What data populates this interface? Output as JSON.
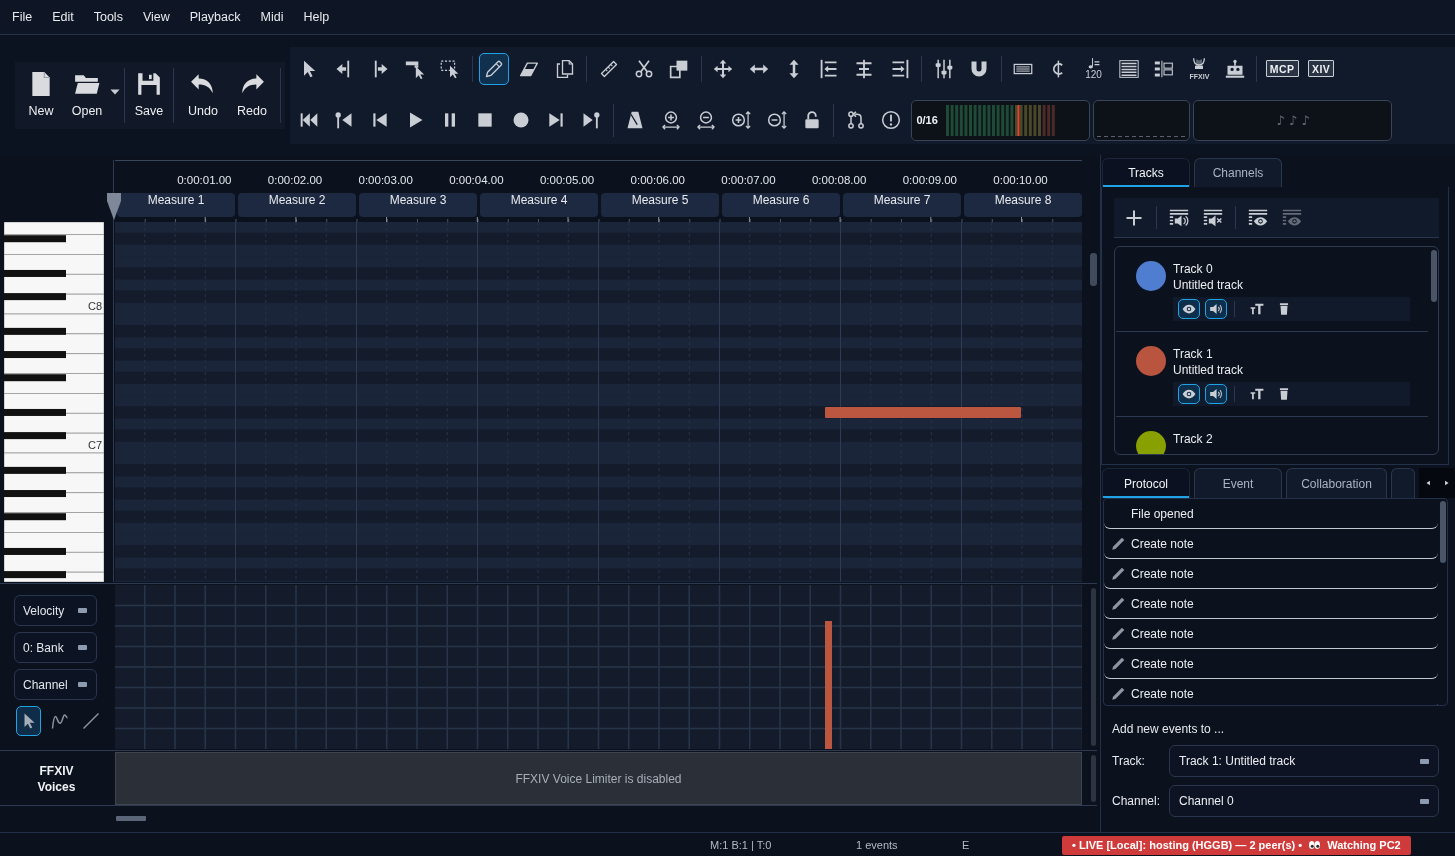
{
  "menu_bar": [
    "File",
    "Edit",
    "Tools",
    "View",
    "Playback",
    "Midi",
    "Help"
  ],
  "file_toolbar": [
    {
      "label": "New",
      "has_menu": false
    },
    {
      "label": "Open",
      "has_menu": true
    },
    {
      "label": "Save",
      "has_menu": false
    },
    {
      "label": "Undo",
      "has_menu": false
    },
    {
      "label": "Redo",
      "has_menu": false
    }
  ],
  "toolbar": {
    "edit_tools": [
      {
        "selected": false
      },
      {
        "selected": false
      },
      {
        "selected": false
      },
      {
        "selected": false
      },
      {
        "selected": false
      },
      {
        "selected": true
      },
      {
        "selected": false
      },
      {
        "selected": false
      }
    ],
    "tempo": "120",
    "ffxiv_label": "FFXIV",
    "mcp_label": "MCP",
    "xiv_label": "XIV",
    "position_counter": "0/16",
    "notes_indicator": "♪ ♪ ♪"
  },
  "ruler": {
    "times": [
      "0:00:01.00",
      "0:00:02.00",
      "0:00:03.00",
      "0:00:04.00",
      "0:00:05.00",
      "0:00:06.00",
      "0:00:07.00",
      "0:00:08.00",
      "0:00:09.00",
      "0:00:10.00"
    ],
    "measures": [
      "Measure 1",
      "Measure 2",
      "Measure 3",
      "Measure 4",
      "Measure 5",
      "Measure 6",
      "Measure 7",
      "Measure 8"
    ]
  },
  "piano_roll": {
    "octave_labels": [
      "C8",
      "C7"
    ],
    "notes": [
      {
        "color": "#bb5641",
        "level": 0.78
      }
    ]
  },
  "controller_panel": {
    "selectors": [
      {
        "value": "Velocity"
      },
      {
        "value": "0: Bank"
      },
      {
        "value": "Channel"
      }
    ],
    "tools": [
      {
        "selected": true
      },
      {
        "selected": false
      },
      {
        "selected": false
      }
    ]
  },
  "voices": {
    "label": "FFXIV Voices",
    "message": "FFXIV Voice Limiter is disabled"
  },
  "track_tabs": [
    {
      "label": "Tracks",
      "selected": true
    },
    {
      "label": "Channels",
      "selected": false
    }
  ],
  "tracks": [
    {
      "name": "Track 0",
      "subtitle": "Untitled track",
      "color": "#4f7dd0",
      "visible": true,
      "audible": true
    },
    {
      "name": "Track 1",
      "subtitle": "Untitled track",
      "color": "#b9553f",
      "visible": true,
      "audible": true
    },
    {
      "name": "Track 2",
      "color": "#88a000"
    }
  ],
  "log_tabs": [
    {
      "label": "Protocol",
      "selected": true
    },
    {
      "label": "Event",
      "selected": false
    },
    {
      "label": "Collaboration",
      "selected": false
    }
  ],
  "protocol": [
    {
      "kind": "file",
      "text": "File opened"
    },
    {
      "kind": "note",
      "text": "Create note"
    },
    {
      "kind": "note",
      "text": "Create note"
    },
    {
      "kind": "note",
      "text": "Create note"
    },
    {
      "kind": "note",
      "text": "Create note"
    },
    {
      "kind": "note",
      "text": "Create note"
    },
    {
      "kind": "note",
      "text": "Create note"
    }
  ],
  "event_target": {
    "heading": "Add new events to ...",
    "fields": [
      {
        "label": "Track:",
        "value": "Track 1: Untitled track"
      },
      {
        "label": "Channel:",
        "value": "Channel 0"
      }
    ]
  },
  "status_bar": {
    "position": "M:1 B:1 | T:0",
    "events": "1 events",
    "mode": "E",
    "live": "• LIVE [Local]: hosting (HGGB) — 2 peer(s) •",
    "watching": "Watching PC2"
  }
}
